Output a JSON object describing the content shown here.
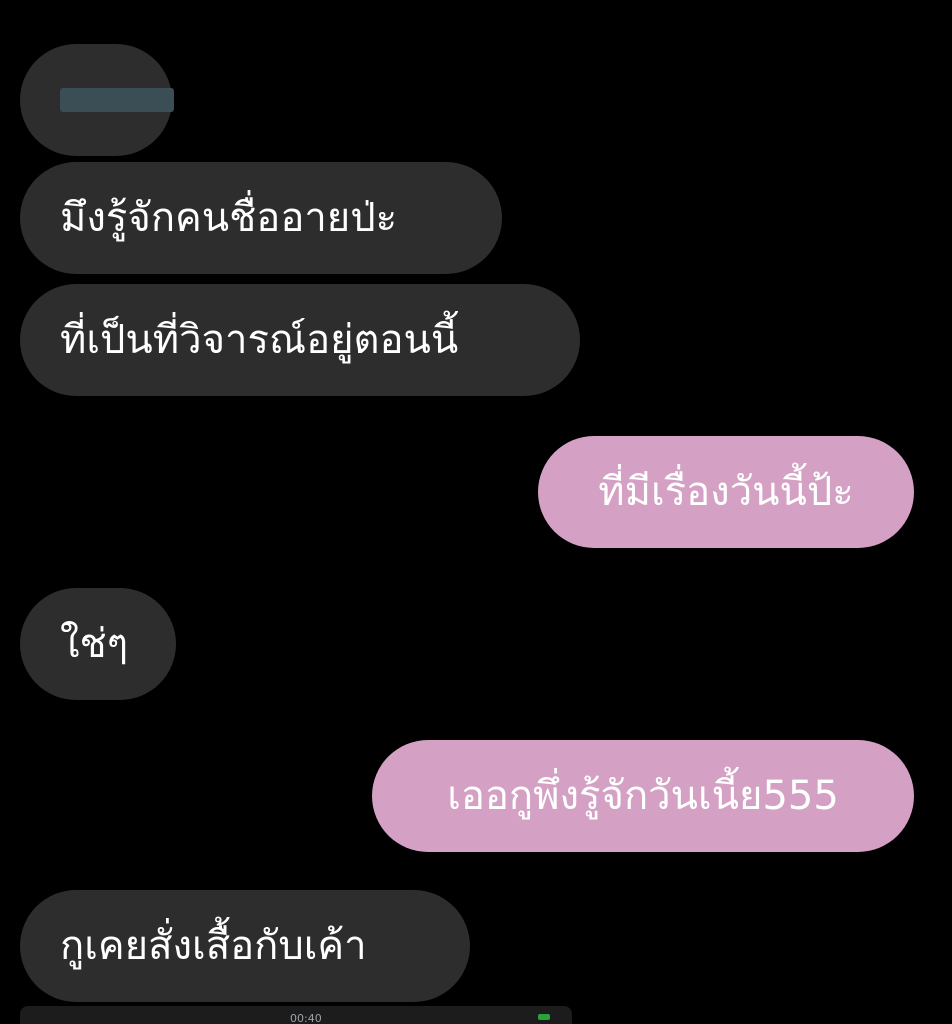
{
  "messages": [
    {
      "side": "received",
      "text": "มึงรู้จักคนชื่ออายป่ะ"
    },
    {
      "side": "received",
      "text": "ที่เป็นที่วิจารณ์อยู่ตอนนี้"
    },
    {
      "side": "sent",
      "text": "ที่มีเรื่องวันนี้ป้ะ"
    },
    {
      "side": "received",
      "text": "ใช่ๆ"
    },
    {
      "side": "sent",
      "text": "เออกูพึ่งรู้จักวันเนี้ย555"
    },
    {
      "side": "received",
      "text": "กูเคยสั่งเสื้อกับเค้า"
    }
  ],
  "colors": {
    "background": "#000000",
    "received_bubble": "#2d2d2d",
    "sent_bubble": "#d4a0c3",
    "bubble_text": "#ffffff"
  },
  "attachment_preview": {
    "time": "00:40"
  }
}
